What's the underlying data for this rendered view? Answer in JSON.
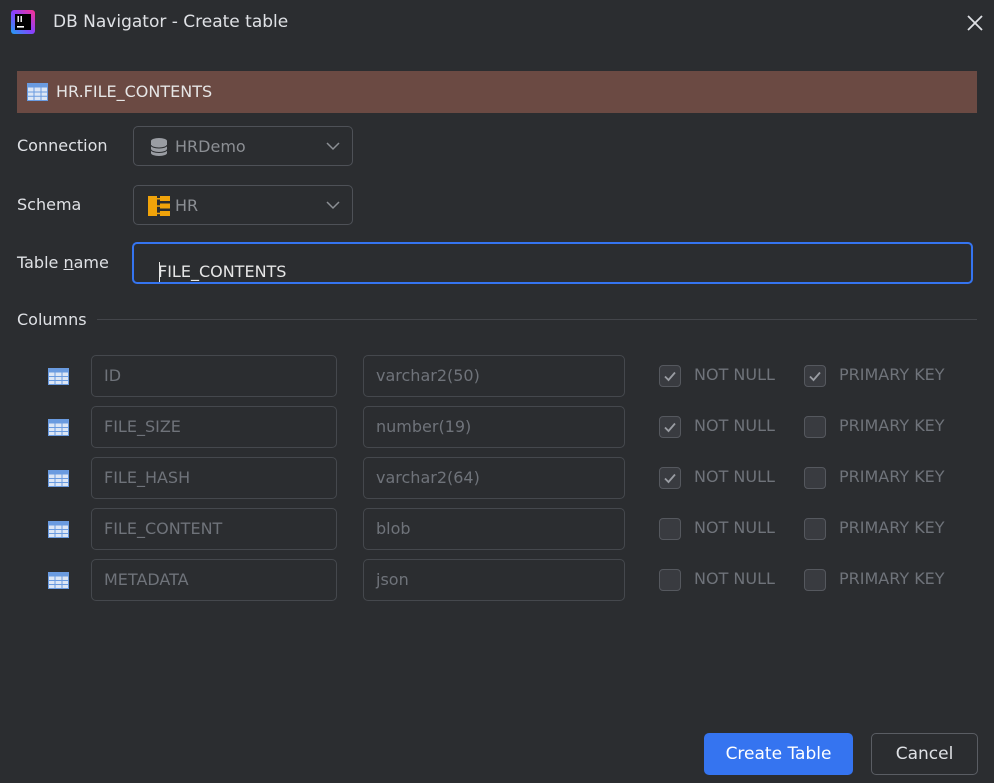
{
  "window": {
    "title": "DB Navigator - Create table",
    "app_icon": "intellij-icon",
    "close_icon": "close-icon"
  },
  "banner": {
    "icon": "table-icon",
    "text": "HR.FILE_CONTENTS",
    "color": "#6b4a43"
  },
  "form": {
    "connection_label": "Connection",
    "connection_value": "HRDemo",
    "connection_icon": "database-icon",
    "schema_label": "Schema",
    "schema_value": "HR",
    "schema_icon": "schema-icon",
    "table_name_label_pre": "Table ",
    "table_name_label_mnemonic": "n",
    "table_name_label_post": "ame",
    "table_name_value": "FILE_CONTENTS"
  },
  "columns": {
    "section_title": "Columns",
    "not_null_label": "NOT NULL",
    "primary_key_label": "PRIMARY KEY",
    "rows": [
      {
        "name": "ID",
        "type": "varchar2(50)",
        "not_null": true,
        "primary_key": true
      },
      {
        "name": "FILE_SIZE",
        "type": "number(19)",
        "not_null": true,
        "primary_key": false
      },
      {
        "name": "FILE_HASH",
        "type": "varchar2(64)",
        "not_null": true,
        "primary_key": false
      },
      {
        "name": "FILE_CONTENT",
        "type": "blob",
        "not_null": false,
        "primary_key": false
      },
      {
        "name": "METADATA",
        "type": "json",
        "not_null": false,
        "primary_key": false
      }
    ]
  },
  "buttons": {
    "create_label": "Create Table",
    "cancel_label": "Cancel"
  },
  "colors": {
    "accent": "#3574f0",
    "background": "#2b2d30"
  }
}
